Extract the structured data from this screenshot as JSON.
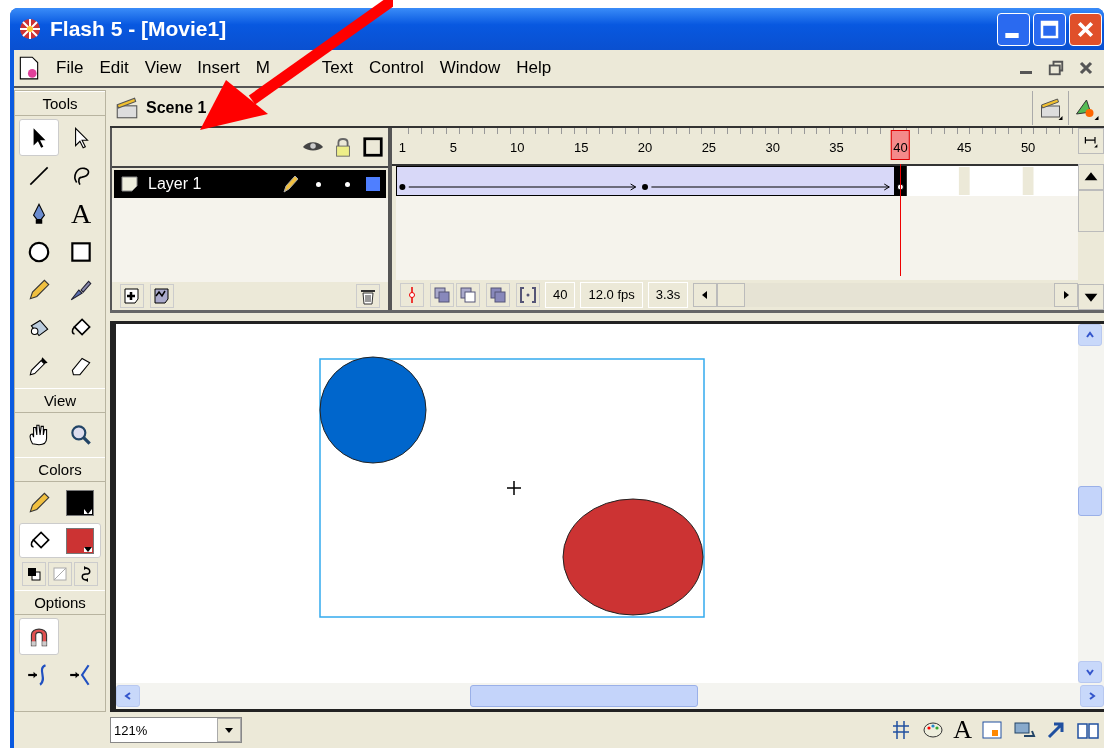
{
  "window": {
    "title": "Flash 5 - [Movie1]"
  },
  "menu": [
    {
      "label": "File"
    },
    {
      "label": "Edit"
    },
    {
      "label": "View"
    },
    {
      "label": "Insert"
    },
    {
      "label": "M"
    },
    {
      "label": "Text"
    },
    {
      "label": "Control"
    },
    {
      "label": "Window"
    },
    {
      "label": "Help"
    }
  ],
  "toolbox": [
    {
      "title": "Tools",
      "tools": [
        {
          "kind": "arrow",
          "selected": true
        },
        {
          "kind": "subselect",
          "selected": false
        },
        {
          "kind": "line",
          "selected": false
        },
        {
          "kind": "lasso",
          "selected": false
        },
        {
          "kind": "pen",
          "selected": false
        },
        {
          "kind": "text",
          "glyph": "A",
          "selected": false
        },
        {
          "kind": "oval",
          "selected": false
        },
        {
          "kind": "rect",
          "selected": false
        },
        {
          "kind": "pencil",
          "selected": false
        },
        {
          "kind": "brush",
          "selected": false
        },
        {
          "kind": "ink",
          "selected": false
        },
        {
          "kind": "bucket",
          "selected": false
        },
        {
          "kind": "dropper",
          "selected": false
        },
        {
          "kind": "eraser",
          "selected": false
        }
      ]
    },
    {
      "title": "View",
      "tools": [
        {
          "kind": "hand",
          "selected": false
        },
        {
          "kind": "zoom",
          "selected": false
        }
      ]
    },
    {
      "title": "Colors",
      "swatches": [
        {
          "kind": "pencil",
          "color": "#000000",
          "selected": false
        },
        {
          "kind": "bucket",
          "color": "#cc3333",
          "selected": true
        }
      ]
    },
    {
      "title": "Options",
      "tools": [
        {
          "kind": "magnet",
          "selected": true
        },
        {
          "kind": "smooth",
          "selected": false
        },
        {
          "kind": "straighten",
          "selected": false
        }
      ]
    }
  ],
  "scene": {
    "name": "Scene 1"
  },
  "timeline": {
    "ticks": [
      {
        "label": "1",
        "current": false
      },
      {
        "label": "5",
        "current": false
      },
      {
        "label": "10",
        "current": false
      },
      {
        "label": "15",
        "current": false
      },
      {
        "label": "20",
        "current": false
      },
      {
        "label": "25",
        "current": false
      },
      {
        "label": "30",
        "current": false
      },
      {
        "label": "35",
        "current": false
      },
      {
        "label": "40",
        "current": true
      },
      {
        "label": "45",
        "current": false
      },
      {
        "label": "50",
        "current": false
      }
    ],
    "layers": [
      {
        "name": "Layer 1",
        "selected": true,
        "color": "#4f7fff"
      }
    ],
    "current_frame": "40",
    "frame_rate": "12.0 fps",
    "elapsed": "3.3s"
  },
  "stage": {
    "shapes": [
      {
        "kind": "ellipse",
        "color": "#0066cc"
      },
      {
        "kind": "ellipse",
        "color": "#cc3333"
      }
    ]
  },
  "status": {
    "zoom": "121%",
    "icons": [
      {
        "kind": "grid"
      },
      {
        "kind": "palette"
      },
      {
        "kind": "text",
        "glyph": "A"
      },
      {
        "kind": "info"
      },
      {
        "kind": "scene"
      },
      {
        "kind": "arrow"
      },
      {
        "kind": "book"
      }
    ]
  }
}
